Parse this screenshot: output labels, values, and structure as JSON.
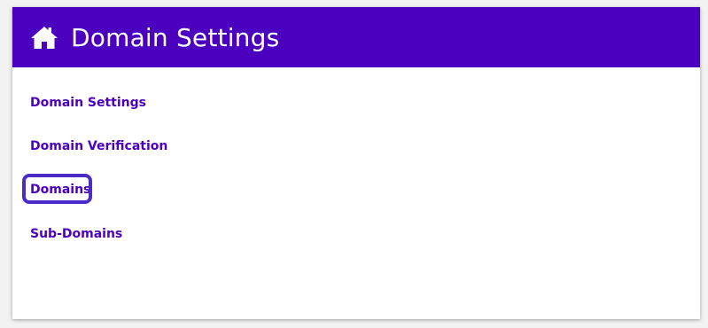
{
  "header": {
    "icon": "home-icon",
    "title": "Domain Settings",
    "background_color": "#4b00bf"
  },
  "menu": {
    "items": [
      {
        "label": "Domain Settings"
      },
      {
        "label": "Domain Verification"
      },
      {
        "label": "Domains",
        "highlighted": true
      },
      {
        "label": "Sub-Domains"
      }
    ],
    "highlight_color": "#4b2bc7"
  }
}
